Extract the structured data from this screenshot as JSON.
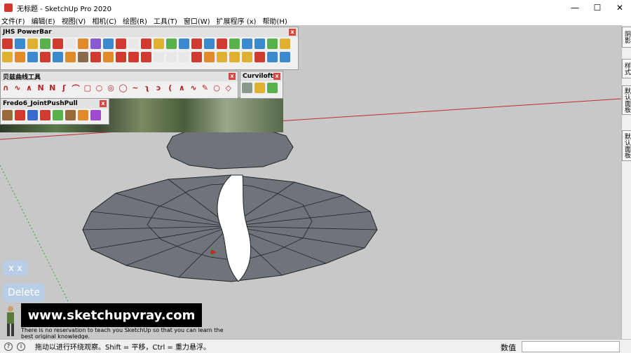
{
  "window": {
    "title": "无标题 - SketchUp Pro 2020",
    "minimize": "—",
    "maximize": "☐",
    "close": "✕"
  },
  "menu": [
    "文件(F)",
    "编辑(E)",
    "视图(V)",
    "相机(C)",
    "绘图(R)",
    "工具(T)",
    "窗口(W)",
    "扩展程序 (x)",
    "帮助(H)"
  ],
  "toolbars": {
    "jhs": {
      "title": "JHS PowerBar",
      "close": "x"
    },
    "bezier": {
      "title": "贝兹曲线工具",
      "close": "x"
    },
    "curviloft": {
      "title": "Curviloft",
      "close": "x"
    },
    "fredo": {
      "title": "Fredo6_JointPushPull",
      "close": "x"
    }
  },
  "right_tabs": [
    "阴影",
    "样式",
    "默认面板",
    "默认面板"
  ],
  "overlay": {
    "xx": "x x",
    "delete": "Delete",
    "website": "www.sketchupvray.com",
    "tagline": "There is no reservation to teach you SketchUp so that you can learn the best original knowledge."
  },
  "status": {
    "hint": "拖动以进行环绕观察。Shift = 平移，Ctrl = 重力悬浮。",
    "measure_label": "数值",
    "measure_value": ""
  },
  "colors": {
    "viewport_bg": "#c8c8c8",
    "face": "#6e7479",
    "edge": "#1f2326",
    "horizon": "#c42b2b"
  }
}
